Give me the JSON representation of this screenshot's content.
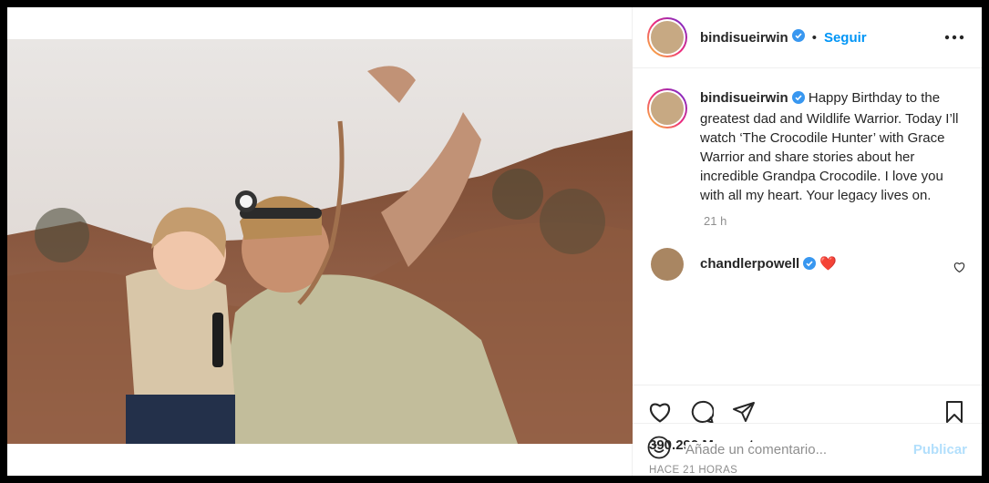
{
  "post": {
    "author": "bindisueirwin",
    "follow_label": "Seguir",
    "separator": "•",
    "caption": "Happy Birthday to the greatest dad and Wildlife Warrior. Today I’ll watch ‘The Crocodile Hunter’ with Grace Warrior and share stories about her incredible Grandpa Crocodile. I love you with all my heart. Your legacy lives on.",
    "caption_time": "21 h",
    "likes": "390.290 Me gusta",
    "posted_ago": "HACE 21 HORAS"
  },
  "comment": {
    "user": "chandlerpowell",
    "text": "❤️"
  },
  "add_comment": {
    "placeholder": "Añade un comentario...",
    "publish_label": "Publicar"
  },
  "icons": [
    "verified-badge-icon",
    "more-options-icon",
    "like-icon",
    "comment-icon",
    "share-icon",
    "save-icon",
    "emoji-icon",
    "small-heart-icon"
  ],
  "colors": {
    "accent": "#0095f6",
    "publish_disabled": "#b2dffc",
    "verified": "#3897f0",
    "heart": "#ed4956"
  }
}
